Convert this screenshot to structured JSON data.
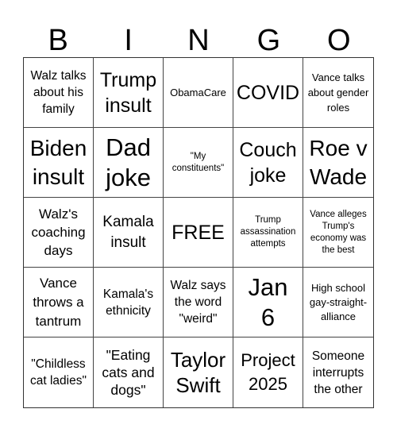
{
  "header": {
    "letters": [
      "B",
      "I",
      "N",
      "G",
      "O"
    ]
  },
  "board": {
    "cells": [
      "Walz talks about his family",
      "Trump insult",
      "ObamaCare",
      "COVID",
      "Vance talks about gender roles",
      "Biden insult",
      "Dad joke",
      "\"My constituents\"",
      "Couch joke",
      "Roe v Wade",
      "Walz's coaching days",
      "Kamala insult",
      "FREE",
      "Trump assassination attempts",
      "Vance alleges Trump's economy was the best",
      "Vance throws a tantrum",
      "Kamala's ethnicity",
      "Walz says the word \"weird\"",
      "Jan 6",
      "High school gay-straight-alliance",
      "\"Childless cat ladies\"",
      "\"Eating cats and dogs\"",
      "Taylor Swift",
      "Project 2025",
      "Someone interrupts the other"
    ]
  }
}
